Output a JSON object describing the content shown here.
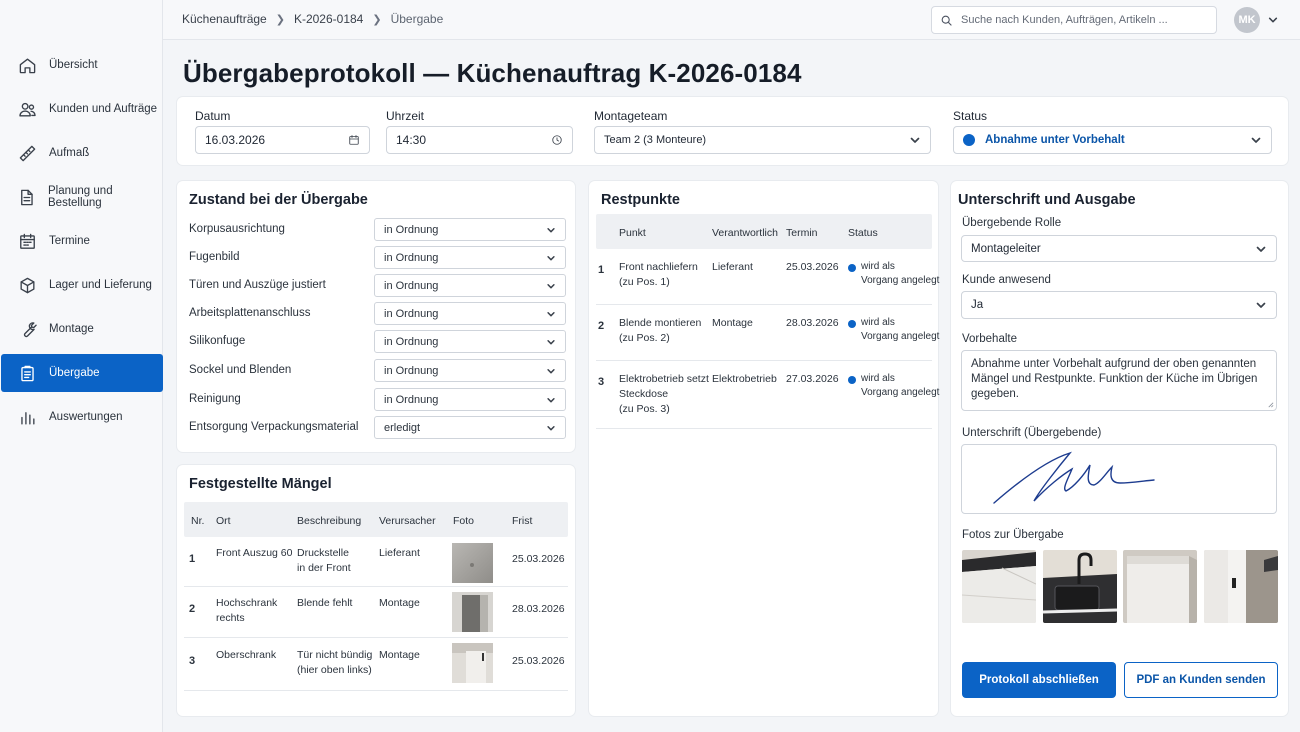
{
  "nav": [
    {
      "label": "Übersicht",
      "icon": "home-icon"
    },
    {
      "label": "Kunden und Aufträge",
      "icon": "users-icon"
    },
    {
      "label": "Aufmaß",
      "icon": "ruler-icon"
    },
    {
      "label": "Planung und Bestellung",
      "icon": "document-icon"
    },
    {
      "label": "Termine",
      "icon": "calendar-icon"
    },
    {
      "label": "Lager und Lieferung",
      "icon": "box-icon"
    },
    {
      "label": "Montage",
      "icon": "wrench-icon"
    },
    {
      "label": "Übergabe",
      "icon": "clipboard-icon"
    },
    {
      "label": "Auswertungen",
      "icon": "bar-chart-icon"
    }
  ],
  "breadcrumb": [
    "Küchenaufträge",
    "K-2026-0184",
    "Übergabe"
  ],
  "search": {
    "placeholder": "Suche nach Kunden, Aufträgen, Artikeln ..."
  },
  "user": {
    "initials": "MK"
  },
  "page": {
    "title": "Übergabeprotokoll — Küchenauftrag K-2026-0184"
  },
  "header": {
    "date_label": "Datum",
    "date_value": "16.03.2026",
    "time_label": "Uhrzeit",
    "time_value": "14:30",
    "team_label": "Montageteam",
    "team_value": "Team 2 (3 Monteure)",
    "status_label": "Status",
    "status_value": "Abnahme unter Vorbehalt",
    "status_color": "#0b63c6"
  },
  "condition": {
    "title": "Zustand bei der Übergabe",
    "items": [
      {
        "label": "Korpusausrichtung",
        "value": "in Ordnung"
      },
      {
        "label": "Fugenbild",
        "value": "in Ordnung"
      },
      {
        "label": "Türen und Auszüge justiert",
        "value": "in Ordnung"
      },
      {
        "label": "Arbeitsplattenanschluss",
        "value": "in Ordnung"
      },
      {
        "label": "Silikonfuge",
        "value": "in Ordnung"
      },
      {
        "label": "Sockel und Blenden",
        "value": "in Ordnung"
      },
      {
        "label": "Reinigung",
        "value": "in Ordnung"
      },
      {
        "label": "Entsorgung Verpackungsmaterial",
        "value": "erledigt"
      }
    ]
  },
  "defects": {
    "title": "Festgestellte Mängel",
    "headers": [
      "Nr.",
      "Ort",
      "Beschreibung",
      "Verursacher",
      "Foto",
      "Frist"
    ],
    "rows": [
      {
        "nr": "1",
        "ort": [
          "Front Auszug 60"
        ],
        "beschreibung": [
          "Druckstelle",
          "in der Front"
        ],
        "verursacher": "Lieferant",
        "frist": "25.03.2026"
      },
      {
        "nr": "2",
        "ort": [
          "Hochschrank",
          "rechts"
        ],
        "beschreibung": [
          "Blende fehlt"
        ],
        "verursacher": "Montage",
        "frist": "28.03.2026"
      },
      {
        "nr": "3",
        "ort": [
          "Oberschrank"
        ],
        "beschreibung": [
          "Tür nicht bündig",
          "(hier oben links)"
        ],
        "verursacher": "Montage",
        "frist": "25.03.2026"
      }
    ]
  },
  "open_items": {
    "title": "Restpunkte",
    "headers": [
      "Punkt",
      "Verantwortlich",
      "Termin",
      "Status"
    ],
    "rows": [
      {
        "nr": "1",
        "punkt": [
          "Front nachliefern",
          "(zu Pos. 1)"
        ],
        "verantwortlich": "Lieferant",
        "termin": "25.03.2026",
        "status": [
          "wird als",
          "Vorgang angelegt"
        ]
      },
      {
        "nr": "2",
        "punkt": [
          "Blende montieren",
          "(zu Pos. 2)"
        ],
        "verantwortlich": "Montage",
        "termin": "28.03.2026",
        "status": [
          "wird als",
          "Vorgang angelegt"
        ]
      },
      {
        "nr": "3",
        "punkt": [
          "Elektrobetrieb setzt",
          "Steckdose",
          "(zu Pos. 3)"
        ],
        "verantwortlich": "Elektrobetrieb",
        "termin": "27.03.2026",
        "status": [
          "wird als",
          "Vorgang angelegt"
        ]
      }
    ]
  },
  "signature": {
    "title": "Unterschrift und Ausgabe",
    "role_label": "Übergebende Rolle",
    "role_value": "Montageleiter",
    "customer_label": "Kunde anwesend",
    "customer_value": "Ja",
    "reservations_label": "Vorbehalte",
    "reservations_value": "Abnahme unter Vorbehalt aufgrund der oben genannten Mängel und Restpunkte. Funktion der Küche im Übrigen gegeben.",
    "signature_label": "Unterschrift (Übergebende)",
    "photos_label": "Fotos zur Übergabe",
    "finish_button": "Protokoll abschließen",
    "pdf_button": "PDF an Kunden senden"
  }
}
